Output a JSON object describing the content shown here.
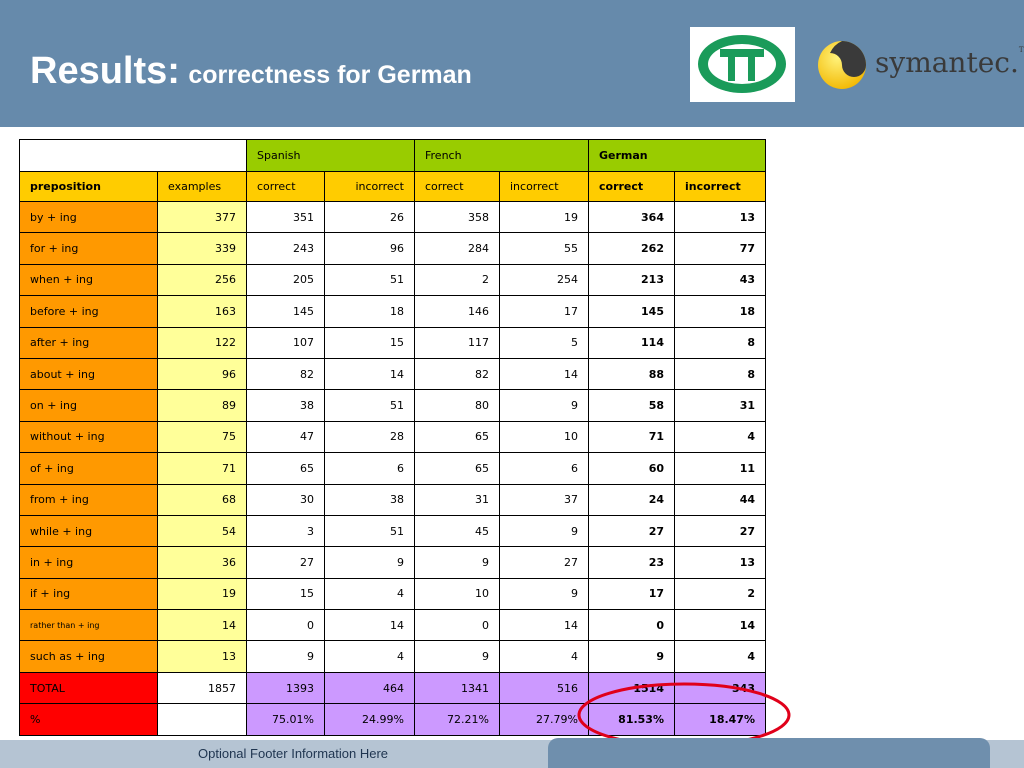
{
  "slide": {
    "title_main": "Results:",
    "title_sub": "correctness for German",
    "footer": "Optional Footer Information Here"
  },
  "logos": {
    "tt_icon": "tt-logo-icon",
    "symantec_text": "symantec.",
    "symantec_tm": "TM"
  },
  "colors": {
    "header": "#668aab",
    "green": "#99cc00",
    "yellow": "#ffcc00",
    "orange": "#ff9900",
    "light_yellow": "#ffff99",
    "purple": "#cc99ff",
    "red": "#ff0000",
    "ellipse": "#e0001a"
  },
  "table": {
    "groups": [
      "Spanish",
      "French",
      "German"
    ],
    "subheaders": [
      "preposition",
      "examples",
      "correct",
      "incorrect",
      "correct",
      "incorrect",
      "correct",
      "incorrect"
    ],
    "rows": [
      {
        "prep": "by + ing",
        "examples": "377",
        "es_c": "351",
        "es_i": "26",
        "fr_c": "358",
        "fr_i": "19",
        "de_c": "364",
        "de_i": "13"
      },
      {
        "prep": "for + ing",
        "examples": "339",
        "es_c": "243",
        "es_i": "96",
        "fr_c": "284",
        "fr_i": "55",
        "de_c": "262",
        "de_i": "77"
      },
      {
        "prep": "when + ing",
        "examples": "256",
        "es_c": "205",
        "es_i": "51",
        "fr_c": "2",
        "fr_i": "254",
        "de_c": "213",
        "de_i": "43"
      },
      {
        "prep": "before + ing",
        "examples": "163",
        "es_c": "145",
        "es_i": "18",
        "fr_c": "146",
        "fr_i": "17",
        "de_c": "145",
        "de_i": "18"
      },
      {
        "prep": "after + ing",
        "examples": "122",
        "es_c": "107",
        "es_i": "15",
        "fr_c": "117",
        "fr_i": "5",
        "de_c": "114",
        "de_i": "8"
      },
      {
        "prep": "about + ing",
        "examples": "96",
        "es_c": "82",
        "es_i": "14",
        "fr_c": "82",
        "fr_i": "14",
        "de_c": "88",
        "de_i": "8"
      },
      {
        "prep": "on + ing",
        "examples": "89",
        "es_c": "38",
        "es_i": "51",
        "fr_c": "80",
        "fr_i": "9",
        "de_c": "58",
        "de_i": "31"
      },
      {
        "prep": "without + ing",
        "examples": "75",
        "es_c": "47",
        "es_i": "28",
        "fr_c": "65",
        "fr_i": "10",
        "de_c": "71",
        "de_i": "4"
      },
      {
        "prep": "of + ing",
        "examples": "71",
        "es_c": "65",
        "es_i": "6",
        "fr_c": "65",
        "fr_i": "6",
        "de_c": "60",
        "de_i": "11"
      },
      {
        "prep": "from + ing",
        "examples": "68",
        "es_c": "30",
        "es_i": "38",
        "fr_c": "31",
        "fr_i": "37",
        "de_c": "24",
        "de_i": "44"
      },
      {
        "prep": "while + ing",
        "examples": "54",
        "es_c": "3",
        "es_i": "51",
        "fr_c": "45",
        "fr_i": "9",
        "de_c": "27",
        "de_i": "27"
      },
      {
        "prep": "in + ing",
        "examples": "36",
        "es_c": "27",
        "es_i": "9",
        "fr_c": "9",
        "fr_i": "27",
        "de_c": "23",
        "de_i": "13"
      },
      {
        "prep": "if + ing",
        "examples": "19",
        "es_c": "15",
        "es_i": "4",
        "fr_c": "10",
        "fr_i": "9",
        "de_c": "17",
        "de_i": "2"
      },
      {
        "prep": "rather than + ing",
        "examples": "14",
        "es_c": "0",
        "es_i": "14",
        "fr_c": "0",
        "fr_i": "14",
        "de_c": "0",
        "de_i": "14"
      },
      {
        "prep": "such as + ing",
        "examples": "13",
        "es_c": "9",
        "es_i": "4",
        "fr_c": "9",
        "fr_i": "4",
        "de_c": "9",
        "de_i": "4"
      }
    ],
    "total": {
      "label": "TOTAL",
      "examples": "1857",
      "es_c": "1393",
      "es_i": "464",
      "fr_c": "1341",
      "fr_i": "516",
      "de_c": "1514",
      "de_i": "343"
    },
    "percent": {
      "label": "%",
      "es_c": "75.01%",
      "es_i": "24.99%",
      "fr_c": "72.21%",
      "fr_i": "27.79%",
      "de_c": "81.53%",
      "de_i": "18.47%"
    }
  }
}
